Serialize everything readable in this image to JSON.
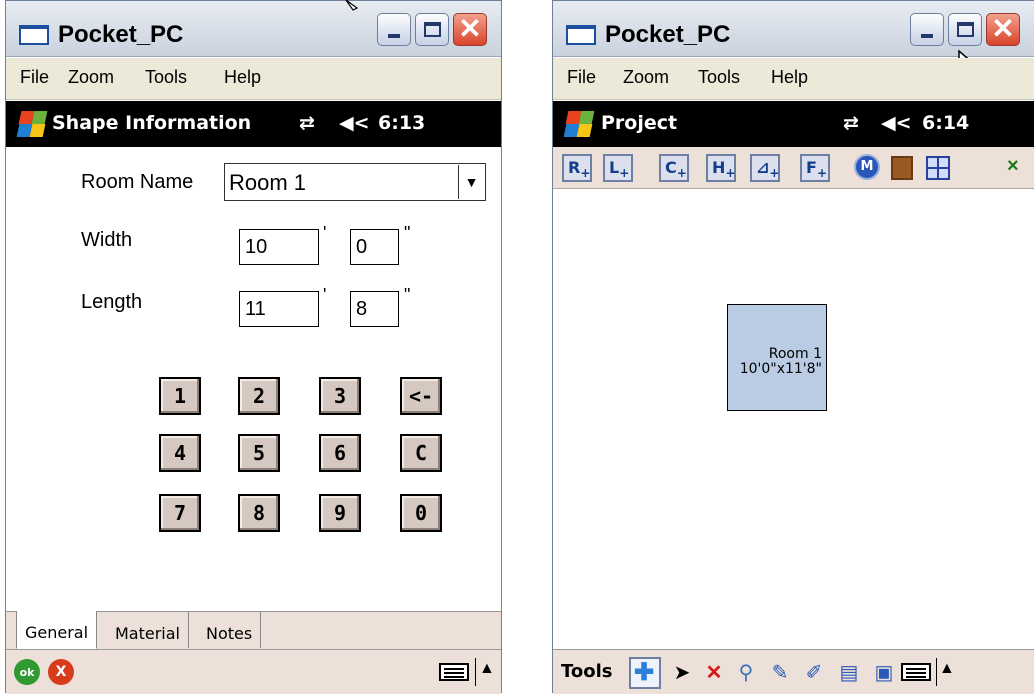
{
  "left": {
    "window_title": "Pocket_PC",
    "menu": [
      "File",
      "Zoom",
      "Tools",
      "Help"
    ],
    "status": {
      "title": "Shape Information",
      "time": "6:13"
    },
    "room_name": {
      "label": "Room Name",
      "value": "Room 1"
    },
    "width": {
      "label": "Width",
      "feet": "10",
      "inches": "0"
    },
    "length": {
      "label": "Length",
      "feet": "11",
      "inches": "8"
    },
    "units": {
      "feet": "'",
      "inches": "\""
    },
    "keypad": [
      "1",
      "2",
      "3",
      "<-",
      "4",
      "5",
      "6",
      "C",
      "7",
      "8",
      "9",
      "0"
    ],
    "tabs": [
      "General",
      "Material",
      "Notes"
    ],
    "ok_label": "ok",
    "cancel_label": "X"
  },
  "right": {
    "window_title": "Pocket_PC",
    "menu": [
      "File",
      "Zoom",
      "Tools",
      "Help"
    ],
    "status": {
      "title": "Project",
      "time": "6:14"
    },
    "toolbar": [
      "R",
      "L",
      "C",
      "H",
      "⊿",
      "F"
    ],
    "toolbar_close": "×",
    "room": {
      "name": "Room 1",
      "dims": "10'0\"x11'8\""
    },
    "tools_label": "Tools"
  },
  "colors": {
    "room_fill": "#b9cce4",
    "statusbar": "#000000",
    "keypad_face": "#d4c8c0",
    "close_button": "#d8452a"
  }
}
